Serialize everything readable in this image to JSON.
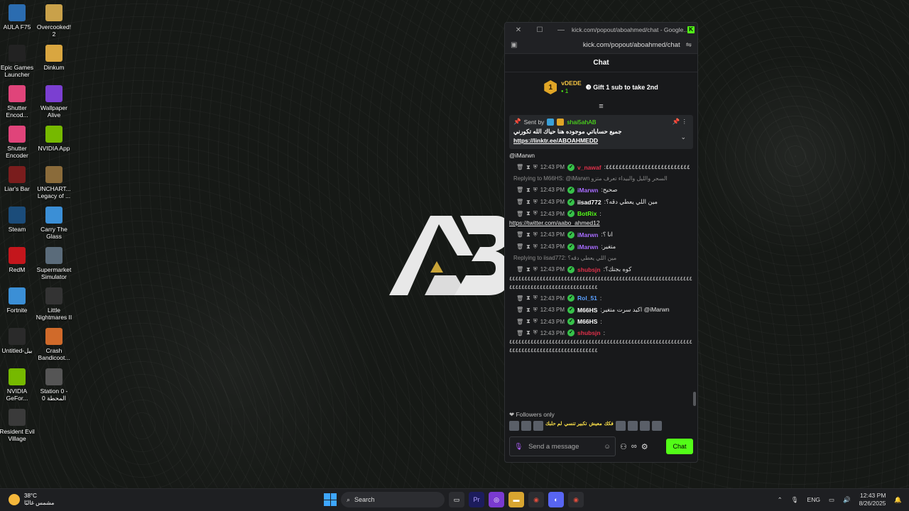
{
  "desktop": {
    "icons": [
      {
        "label": "AULA F75",
        "icon": "keyboard-icon",
        "color": "#2b6cb0"
      },
      {
        "label": "Overcooked! 2",
        "icon": "game-icon",
        "color": "#c9a14a"
      },
      {
        "label": "Epic Games Launcher",
        "icon": "epic-icon",
        "color": "#222222"
      },
      {
        "label": "Dinkum",
        "icon": "game-icon",
        "color": "#d9a640"
      },
      {
        "label": "Shutter Encod...",
        "icon": "shutter-icon",
        "color": "#e0447a"
      },
      {
        "label": "Wallpaper Alive",
        "icon": "wallpaper-icon",
        "color": "#7b3fd1"
      },
      {
        "label": "Shutter Encoder",
        "icon": "shutter-icon",
        "color": "#e0447a"
      },
      {
        "label": "NVIDIA App",
        "icon": "nvidia-icon",
        "color": "#76b900"
      },
      {
        "label": "Liar's Bar",
        "icon": "game-icon",
        "color": "#7a1d1d"
      },
      {
        "label": "UNCHART... Legacy of ...",
        "icon": "game-icon",
        "color": "#8a6b3a"
      },
      {
        "label": "Steam",
        "icon": "steam-icon",
        "color": "#1b4c7a"
      },
      {
        "label": "Carry The Glass",
        "icon": "game-icon",
        "color": "#3b8fd6"
      },
      {
        "label": "RedM",
        "icon": "redm-icon",
        "color": "#c4161c"
      },
      {
        "label": "Supermarket Simulator",
        "icon": "game-icon",
        "color": "#5a6b7a"
      },
      {
        "label": "Fortnite",
        "icon": "fortnite-icon",
        "color": "#3b8fd6"
      },
      {
        "label": "Little Nightmares II",
        "icon": "game-icon",
        "color": "#333333"
      },
      {
        "label": "Untitled-بيل",
        "icon": "file-icon",
        "color": "#2a2a2a"
      },
      {
        "label": "Crash Bandicoot...",
        "icon": "game-icon",
        "color": "#d06a2a"
      },
      {
        "label": "NVIDIA GeFor...",
        "icon": "nvidia-icon",
        "color": "#76b900"
      },
      {
        "label": "Station 0 - المحطة 0",
        "icon": "game-icon",
        "color": "#555555"
      },
      {
        "label": "Resident Evil Village",
        "icon": "game-icon",
        "color": "#3a3a3a"
      }
    ]
  },
  "window": {
    "title": "kick.com/popout/aboahmed/chat - Google...",
    "url": "kick.com/popout/aboahmed/chat",
    "brand_color": "#53fc18"
  },
  "chat": {
    "header": "Chat",
    "top_sub": {
      "rank": "1",
      "user": "vDEDE",
      "count": "1",
      "gift_text": "Gift 1 sub to take 2nd"
    },
    "pinned": {
      "sent_by": "Sent by",
      "user": "shai5ahAB",
      "message": "جميع حساباتي موجوده هنا حياك الله تكورني",
      "link": "https://linktr.ee/ABOAHMEDD",
      "trailing": "@iMarwn"
    },
    "messages": [
      {
        "time": "12:43 PM",
        "user": "v_nawaf",
        "user_color": "#e0304a",
        "text": ":٤٤٤٤٤٤٤٤٤٤٤٤٤٤٤٤٤٤٤٤٤٤٤٤٤٤"
      },
      {
        "reply": "Replying to M66HS: @iMarwn السحر والليل والبيداء تعرف متزو",
        "time": "12:43 PM",
        "user": "iMarwn",
        "user_color": "#a86cff",
        "text": ":صحيح"
      },
      {
        "time": "12:43 PM",
        "user": "iisad772",
        "user_color": "#ffffff",
        "text": ":مين اللي يعطي دقه؟"
      },
      {
        "time": "12:43 PM",
        "user": "BotRix",
        "user_color": "#53fc18",
        "text": ":",
        "link": "https://twitter.com/aabo_ahmed12"
      },
      {
        "time": "12:43 PM",
        "user": "iMarwn",
        "user_color": "#a86cff",
        "text": ":انا ؟"
      },
      {
        "time": "12:43 PM",
        "user": "iMarwn",
        "user_color": "#a86cff",
        "text": ":متغير"
      },
      {
        "reply": "Replying to iisad772: مين اللي يعطي دقه؟",
        "time": "12:43 PM",
        "user": "shubsjn",
        "user_color": "#e0304a",
        "text": ":كوه بجنك؟",
        "cont1": "٤٤٤٤٤٤٤٤٤٤٤٤٤٤٤٤٤٤٤٤٤٤٤٤٤٤٤٤٤٤٤٤٤٤٤٤٤٤٤٤٤٤٤٤٤٤٤٤٤٤٤٤٤٤٤٤٤٤٤٤",
        "cont2": "٤٤٤٤٤٤٤٤٤٤٤٤٤٤٤٤٤٤٤٤٤٤٤٤٤٤٤٤٤"
      },
      {
        "time": "12:43 PM",
        "user": "Rol_51",
        "user_color": "#5aa0ff",
        "text": ":"
      },
      {
        "time": "12:43 PM",
        "user": "M66HS",
        "user_color": "#ffffff",
        "text": ":اكيد سرت متغير @iMarwn"
      },
      {
        "time": "12:43 PM",
        "user": "M66HS",
        "user_color": "#ffffff",
        "text": ":"
      },
      {
        "time": "12:43 PM",
        "user": "shubsjn",
        "user_color": "#e0304a",
        "text": ":",
        "cont1": "٤٤٤٤٤٤٤٤٤٤٤٤٤٤٤٤٤٤٤٤٤٤٤٤٤٤٤٤٤٤٤٤٤٤٤٤٤٤٤٤٤٤٤٤٤٤٤٤٤٤٤٤٤٤٤٤٤٤٤٤",
        "cont2": "٤٤٤٤٤٤٤٤٤٤٤٤٤٤٤٤٤٤٤٤٤٤٤٤٤٤٤٤٤"
      }
    ],
    "followers_only": "Followers only",
    "emote_texts": [
      "لم حلبك",
      "تكبير تنسي",
      "معيش",
      "فكك"
    ],
    "input_placeholder": "Send a message",
    "send_label": "Chat",
    "infinity": "∞"
  },
  "taskbar": {
    "weather_temp": "38°C",
    "weather_text": "مشمس غالبًا",
    "search_label": "Search",
    "lang": "ENG",
    "time": "12:43 PM",
    "date": "8/26/2025"
  }
}
